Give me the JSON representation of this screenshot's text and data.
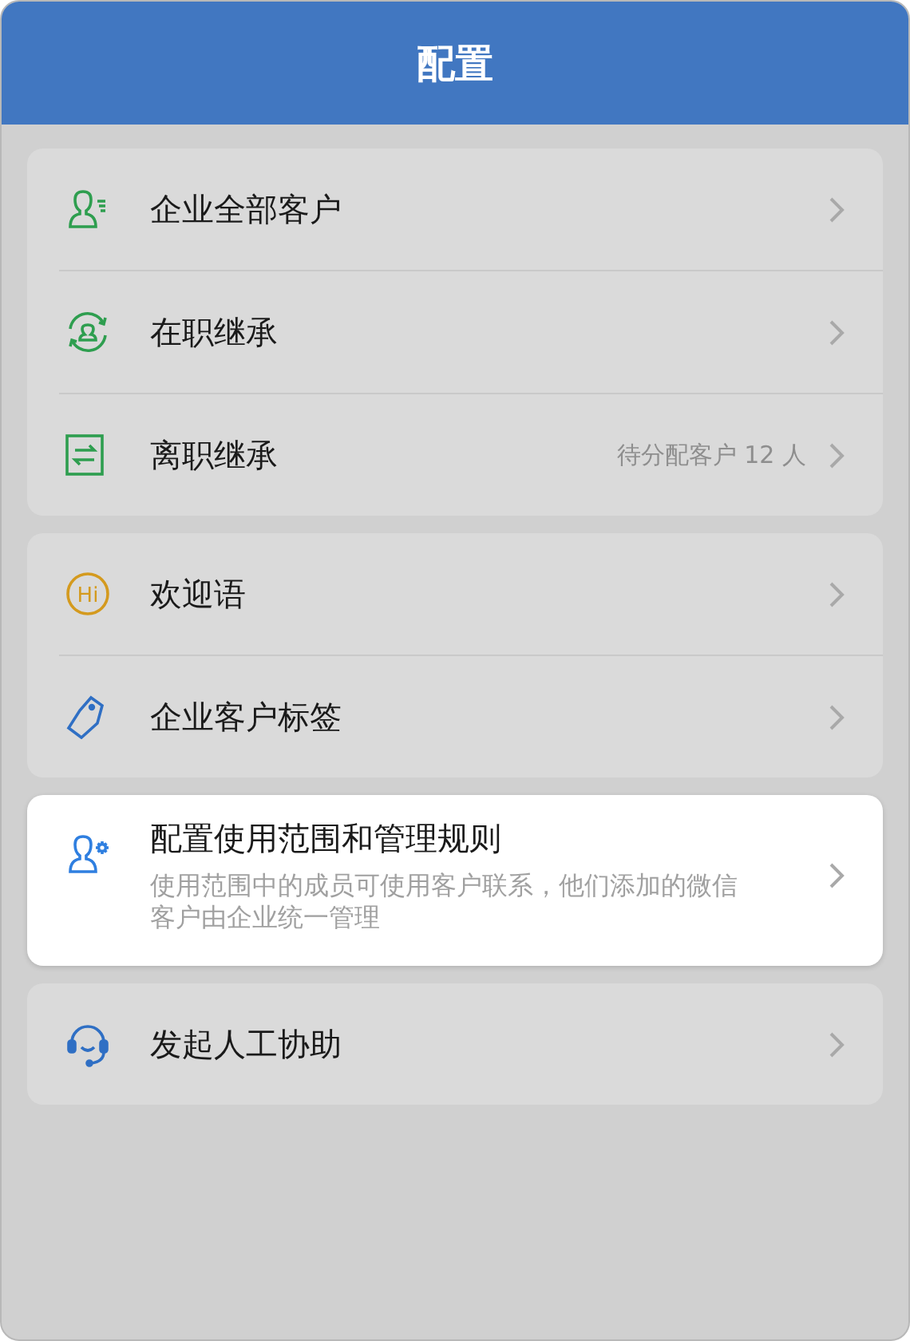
{
  "header": {
    "title": "配置"
  },
  "groups": [
    {
      "selected": false,
      "items": [
        {
          "kind": "person-list",
          "color": "#2e9e4f",
          "label": "企业全部客户"
        },
        {
          "kind": "person-cycle",
          "color": "#2e9e4f",
          "label": "在职继承"
        },
        {
          "kind": "transfer",
          "color": "#2e9e4f",
          "label": "离职继承",
          "note": "待分配客户 12 人"
        }
      ]
    },
    {
      "selected": false,
      "items": [
        {
          "kind": "hi",
          "color": "#d49a1e",
          "icon_text": "Hi",
          "label": "欢迎语"
        },
        {
          "kind": "tag",
          "color": "#2f6fc4",
          "label": "企业客户标签"
        }
      ]
    },
    {
      "selected": true,
      "items": [
        {
          "kind": "person-gear",
          "color": "#2f7fe0",
          "label": "配置使用范围和管理规则",
          "description": "使用范围中的成员可使用客户联系，他们添加的微信客户由企业统一管理"
        }
      ]
    },
    {
      "selected": false,
      "items": [
        {
          "kind": "headset",
          "color": "#2f6fc4",
          "label": "发起人工协助"
        }
      ]
    }
  ]
}
